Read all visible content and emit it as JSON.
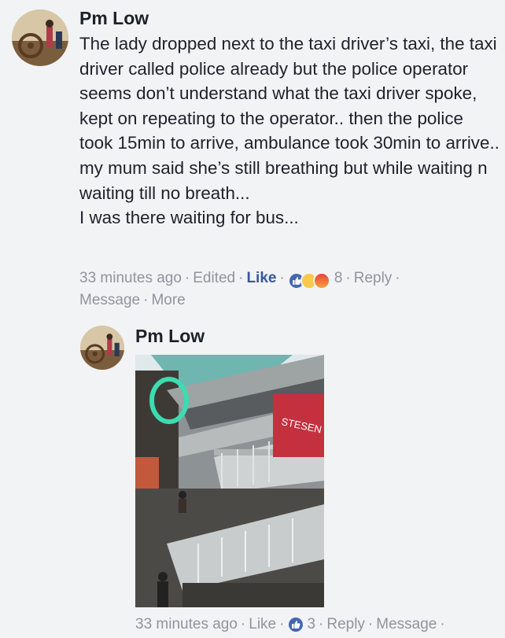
{
  "comment": {
    "author": "Pm Low",
    "text": "The lady dropped next to the taxi driver’s taxi, the taxi driver called police already but the police operator seems don’t understand what the taxi driver spoke, kept on repeating to the operator.. then the police took 15min to arrive, ambulance took 30min to arrive.. my mum said she’s still breathing but while waiting n waiting till no breath...\nI was there waiting for bus...",
    "timestamp": "33 minutes ago",
    "edited_label": "Edited",
    "like_label": "Like",
    "reaction_count": "8",
    "reply_label": "Reply",
    "message_label": "Message",
    "more_label": "More",
    "reaction_icons": [
      "like-icon",
      "sad-icon",
      "angry-icon"
    ]
  },
  "reply": {
    "author": "Pm Low",
    "photo_sign_text": "STESEN",
    "timestamp": "33 minutes ago",
    "like_label": "Like",
    "reaction_count": "3",
    "reply_label": "Reply",
    "message_label": "Message",
    "reaction_icons": [
      "like-icon"
    ]
  },
  "colors": {
    "background": "#f2f3f5",
    "link": "#365899",
    "meta_text": "#90949c",
    "like_blue": "#4267b2",
    "circle_highlight": "#3ddbb0"
  }
}
